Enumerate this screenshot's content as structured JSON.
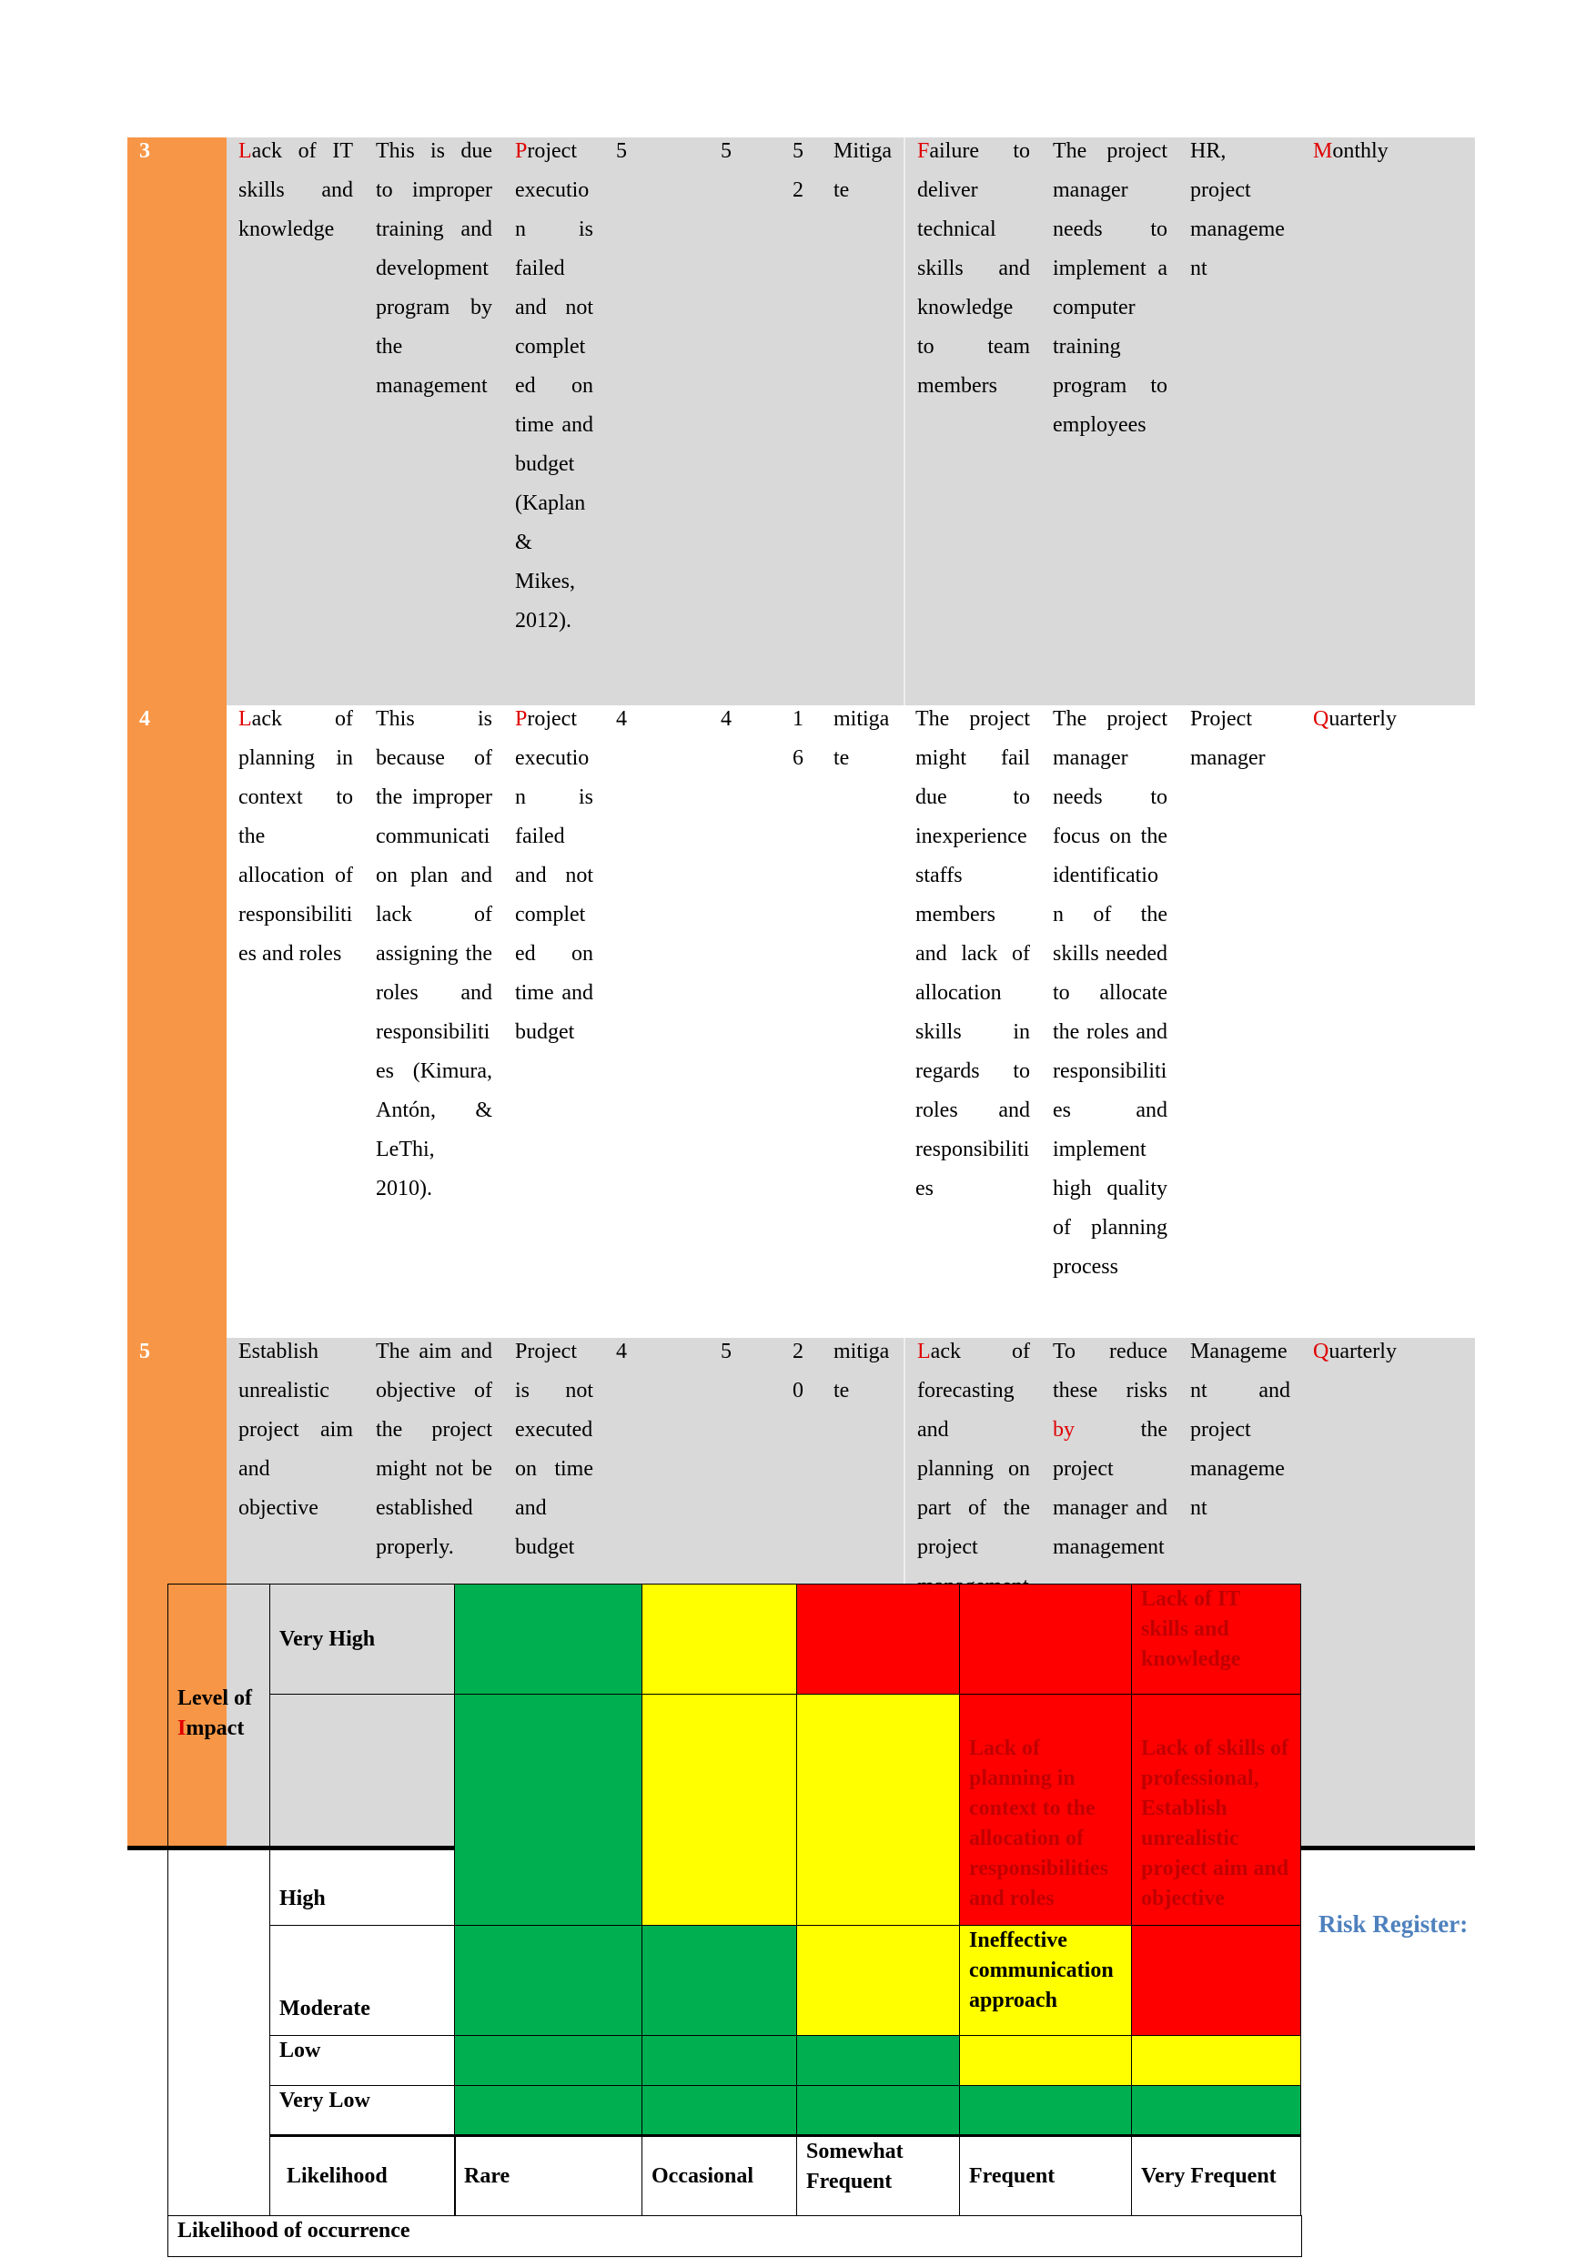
{
  "colors": {
    "orange": "#f79646",
    "gray": "#d9d9d9",
    "green": "#00b050",
    "yellow": "#ffff00",
    "red": "#ff0000",
    "accent_red": "#e00000",
    "blue": "#4f81bd"
  },
  "register_rows": [
    {
      "bg": "gray",
      "cells": [
        [
          {
            "t": "3"
          }
        ],
        [
          {
            "t": "L",
            "red": true
          },
          {
            "t": "ack of IT skills and knowledge"
          }
        ],
        [
          {
            "t": "This is due to improper training and development program by the management"
          }
        ],
        [
          {
            "t": "P",
            "red": true
          },
          {
            "t": "roject execution is failed and not completed on time and budget (Kaplan & Mikes, 2012)."
          }
        ],
        [
          {
            "t": "5"
          }
        ],
        [
          {
            "t": "5"
          }
        ],
        [
          {
            "t": "52"
          }
        ],
        [
          {
            "t": "Mitigate"
          }
        ],
        [
          {
            "t": "F",
            "red": true
          },
          {
            "t": "ailure to deliver technical skills and knowledge to team members"
          }
        ],
        [
          {
            "t": "The project manager needs to implement a computer training program to employees"
          }
        ],
        [
          {
            "t": "HR, project management"
          }
        ],
        [
          {
            "t": "M",
            "red": true
          },
          {
            "t": "onthly"
          }
        ]
      ]
    },
    {
      "bg": "white",
      "cells": [
        [
          {
            "t": "4"
          }
        ],
        [
          {
            "t": "L",
            "red": true
          },
          {
            "t": "ack of planning in context to the allocation of responsibilities and roles"
          }
        ],
        [
          {
            "t": "This is because of the improper communication plan and lack of assigning the roles and responsibilities (Kimura, Antón, & LeThi, 2010)."
          }
        ],
        [
          {
            "t": "P",
            "red": true
          },
          {
            "t": "roject execution is failed and not completed on time and budget"
          }
        ],
        [
          {
            "t": "4"
          }
        ],
        [
          {
            "t": "4"
          }
        ],
        [
          {
            "t": "16"
          }
        ],
        [
          {
            "t": "mitigate"
          }
        ],
        [
          {
            "t": "The project might fail due to inexperience staffs members and lack of allocation skills in regards to roles and responsibilities"
          }
        ],
        [
          {
            "t": "The project manager needs to focus on the identification of the skills needed to allocate the roles and responsibilities and implement high quality of planning process"
          }
        ],
        [
          {
            "t": "Project manager"
          }
        ],
        [
          {
            "t": "Q",
            "red": true
          },
          {
            "t": "uarterly"
          }
        ]
      ]
    },
    {
      "bg": "gray",
      "cells": [
        [
          {
            "t": "5"
          }
        ],
        [
          {
            "t": "Establish unrealistic project aim and objective"
          }
        ],
        [
          {
            "t": "The aim and objective of the project might not be established properly."
          }
        ],
        [
          {
            "t": "Project is not executed on time and budget"
          }
        ],
        [
          {
            "t": "4"
          }
        ],
        [
          {
            "t": "5"
          }
        ],
        [
          {
            "t": "20"
          }
        ],
        [
          {
            "t": "mitigate"
          }
        ],
        [
          {
            "t": "L",
            "red": true
          },
          {
            "t": "ack of forecasting and planning on part of the project management"
          }
        ],
        [
          {
            "t": "To reduce these risks "
          },
          {
            "t": "by",
            "red": true
          },
          {
            "t": " the project manager and management"
          }
        ],
        [
          {
            "t": "Management and project management"
          }
        ],
        [
          {
            "t": "Q",
            "red": true
          },
          {
            "t": "uarterly"
          }
        ]
      ]
    }
  ],
  "matrix": {
    "axis_label_first": "I",
    "axis_label_pre": "Level of ",
    "axis_label_rest": "mpact",
    "impact_levels": [
      "Very High",
      "High",
      "Moderate",
      "Low",
      "Very Low"
    ],
    "grid": [
      [
        "green",
        "yellow",
        "red",
        "red",
        "red"
      ],
      [
        "green",
        "yellow",
        "yellow",
        "red",
        "red"
      ],
      [
        "green",
        "green",
        "yellow",
        "yellow",
        "red"
      ],
      [
        "green",
        "green",
        "green",
        "yellow",
        "yellow"
      ],
      [
        "green",
        "green",
        "green",
        "green",
        "green"
      ]
    ],
    "cell_text": [
      [
        "",
        "",
        "",
        "",
        "Lack of IT skills and knowledge"
      ],
      [
        "",
        "",
        "",
        "Lack of planning in context to the allocation of responsibilities and roles",
        "Lack of skills of professional, Establish unrealistic project aim and objective"
      ],
      [
        "",
        "",
        "",
        "Ineffective communication approach",
        ""
      ],
      [
        "",
        "",
        "",
        "",
        ""
      ],
      [
        "",
        "",
        "",
        "",
        ""
      ]
    ],
    "likelihood_header": "Likelihood",
    "likelihood_levels": [
      "Rare",
      "Occasional",
      "Somewhat Frequent",
      "Frequent",
      "Very Frequent"
    ],
    "footer": "Likelihood of occurrence"
  },
  "side_label": "Risk Register:"
}
